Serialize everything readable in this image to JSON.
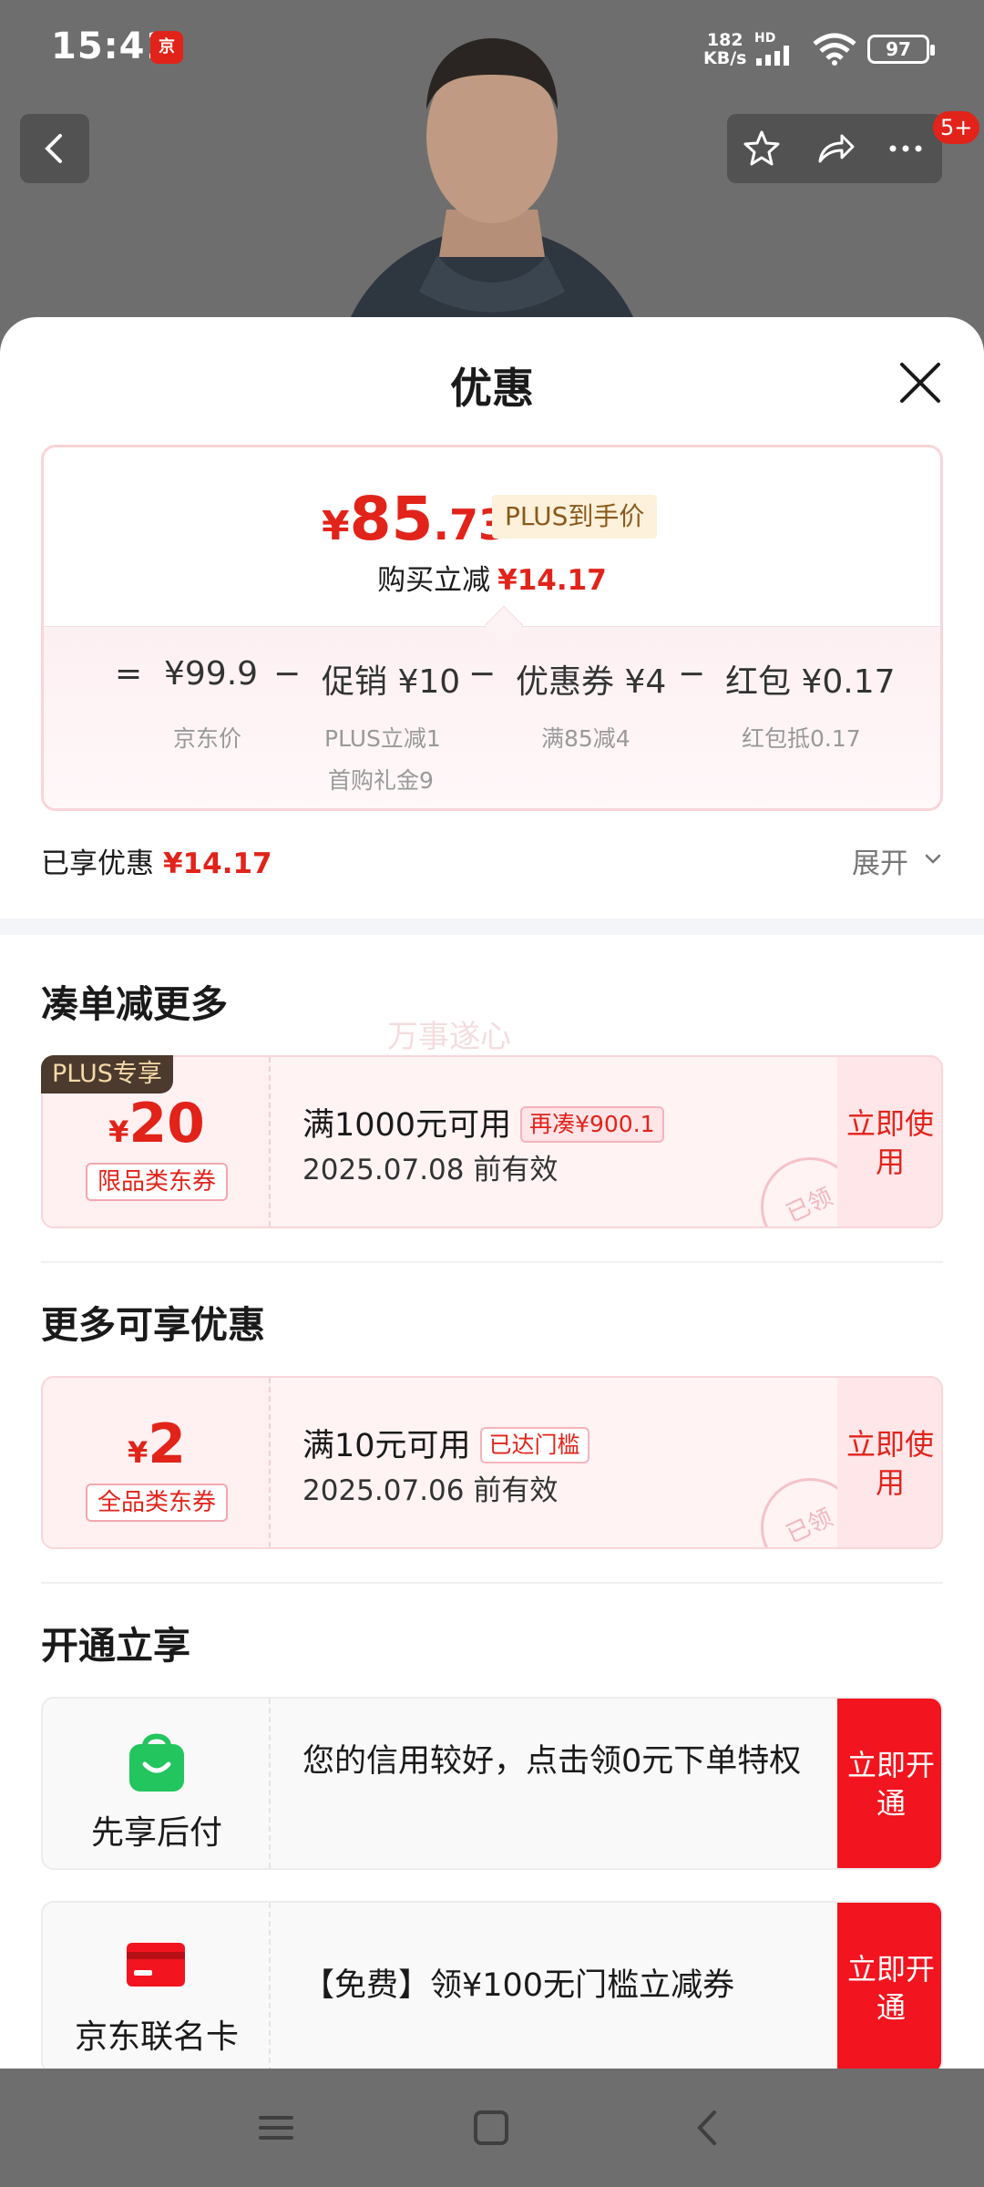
{
  "status_bar": {
    "time": "15:41",
    "net_speed_value": "182",
    "net_speed_unit": "KB/s",
    "hd": "HD",
    "battery": "97"
  },
  "header": {
    "message_badge": "5+"
  },
  "sheet": {
    "title": "优惠",
    "price": {
      "currency": "¥",
      "integer": "85",
      "decimal": ".73",
      "plus_tag": "PLUS到手价",
      "reduce_label": "购买立减",
      "reduce_amount": "¥14.17"
    },
    "breakdown": {
      "equals": "=",
      "minus": "−",
      "items": [
        {
          "value": "¥99.9",
          "sub1": "京东价",
          "sub2": ""
        },
        {
          "value": "促销 ¥10",
          "sub1": "PLUS立减1",
          "sub2": "首购礼金9"
        },
        {
          "value": "优惠券 ¥4",
          "sub1": "满85减4",
          "sub2": ""
        },
        {
          "value": "红包 ¥0.17",
          "sub1": "红包抵0.17",
          "sub2": ""
        }
      ]
    },
    "enjoyed": {
      "label": "已享优惠",
      "amount": "¥14.17",
      "expand": "展开"
    },
    "sections": {
      "more_combine": "凑单减更多",
      "more_offers": "更多可享优惠",
      "open_enjoy": "开通立享"
    },
    "coupons": [
      {
        "badge": "PLUS专享",
        "symbol": "¥",
        "amount": "20",
        "category": "限品类东券",
        "condition": "满1000元可用",
        "pill": "再凑¥900.1",
        "validity": "2025.07.08 前有效",
        "action": "立即使用",
        "stamp": "已领"
      },
      {
        "symbol": "¥",
        "amount": "2",
        "category": "全品类东券",
        "condition": "满10元可用",
        "pill": "已达门槛",
        "validity": "2025.07.06 前有效",
        "action": "立即使用",
        "stamp": "已领"
      }
    ],
    "watermark": "万事遂心",
    "open_items": [
      {
        "label": "先享后付",
        "desc": "您的信用较好，点击领0元下单特权",
        "action": "立即开通",
        "icon_color": "#22c55e"
      },
      {
        "label": "京东联名卡",
        "desc": "【免费】领¥100无门槛立减券",
        "action": "立即开通",
        "icon_color": "#f2141e"
      }
    ]
  },
  "colors": {
    "accent_red": "#e2231a",
    "button_red": "#f2141e"
  }
}
